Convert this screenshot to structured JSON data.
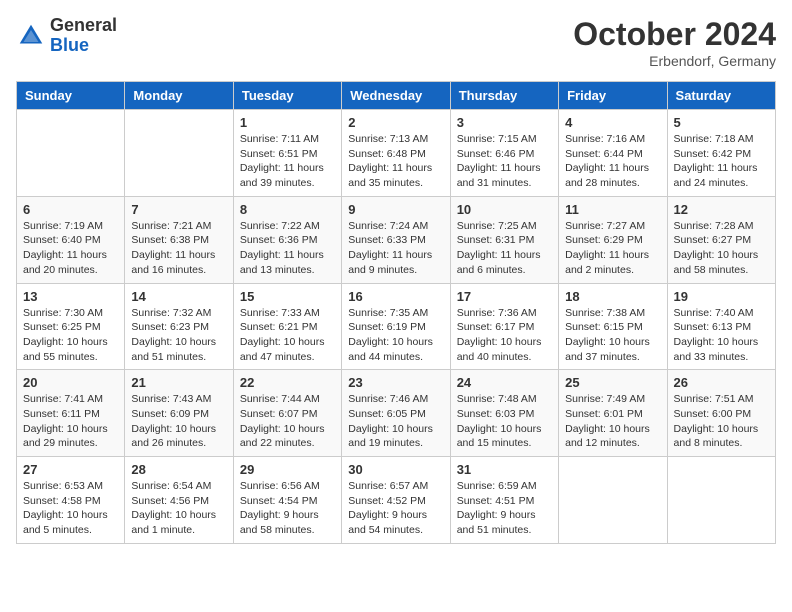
{
  "header": {
    "logo_general": "General",
    "logo_blue": "Blue",
    "month_title": "October 2024",
    "subtitle": "Erbendorf, Germany"
  },
  "days_of_week": [
    "Sunday",
    "Monday",
    "Tuesday",
    "Wednesday",
    "Thursday",
    "Friday",
    "Saturday"
  ],
  "weeks": [
    [
      {
        "day": "",
        "detail": ""
      },
      {
        "day": "",
        "detail": ""
      },
      {
        "day": "1",
        "detail": "Sunrise: 7:11 AM\nSunset: 6:51 PM\nDaylight: 11 hours and 39 minutes."
      },
      {
        "day": "2",
        "detail": "Sunrise: 7:13 AM\nSunset: 6:48 PM\nDaylight: 11 hours and 35 minutes."
      },
      {
        "day": "3",
        "detail": "Sunrise: 7:15 AM\nSunset: 6:46 PM\nDaylight: 11 hours and 31 minutes."
      },
      {
        "day": "4",
        "detail": "Sunrise: 7:16 AM\nSunset: 6:44 PM\nDaylight: 11 hours and 28 minutes."
      },
      {
        "day": "5",
        "detail": "Sunrise: 7:18 AM\nSunset: 6:42 PM\nDaylight: 11 hours and 24 minutes."
      }
    ],
    [
      {
        "day": "6",
        "detail": "Sunrise: 7:19 AM\nSunset: 6:40 PM\nDaylight: 11 hours and 20 minutes."
      },
      {
        "day": "7",
        "detail": "Sunrise: 7:21 AM\nSunset: 6:38 PM\nDaylight: 11 hours and 16 minutes."
      },
      {
        "day": "8",
        "detail": "Sunrise: 7:22 AM\nSunset: 6:36 PM\nDaylight: 11 hours and 13 minutes."
      },
      {
        "day": "9",
        "detail": "Sunrise: 7:24 AM\nSunset: 6:33 PM\nDaylight: 11 hours and 9 minutes."
      },
      {
        "day": "10",
        "detail": "Sunrise: 7:25 AM\nSunset: 6:31 PM\nDaylight: 11 hours and 6 minutes."
      },
      {
        "day": "11",
        "detail": "Sunrise: 7:27 AM\nSunset: 6:29 PM\nDaylight: 11 hours and 2 minutes."
      },
      {
        "day": "12",
        "detail": "Sunrise: 7:28 AM\nSunset: 6:27 PM\nDaylight: 10 hours and 58 minutes."
      }
    ],
    [
      {
        "day": "13",
        "detail": "Sunrise: 7:30 AM\nSunset: 6:25 PM\nDaylight: 10 hours and 55 minutes."
      },
      {
        "day": "14",
        "detail": "Sunrise: 7:32 AM\nSunset: 6:23 PM\nDaylight: 10 hours and 51 minutes."
      },
      {
        "day": "15",
        "detail": "Sunrise: 7:33 AM\nSunset: 6:21 PM\nDaylight: 10 hours and 47 minutes."
      },
      {
        "day": "16",
        "detail": "Sunrise: 7:35 AM\nSunset: 6:19 PM\nDaylight: 10 hours and 44 minutes."
      },
      {
        "day": "17",
        "detail": "Sunrise: 7:36 AM\nSunset: 6:17 PM\nDaylight: 10 hours and 40 minutes."
      },
      {
        "day": "18",
        "detail": "Sunrise: 7:38 AM\nSunset: 6:15 PM\nDaylight: 10 hours and 37 minutes."
      },
      {
        "day": "19",
        "detail": "Sunrise: 7:40 AM\nSunset: 6:13 PM\nDaylight: 10 hours and 33 minutes."
      }
    ],
    [
      {
        "day": "20",
        "detail": "Sunrise: 7:41 AM\nSunset: 6:11 PM\nDaylight: 10 hours and 29 minutes."
      },
      {
        "day": "21",
        "detail": "Sunrise: 7:43 AM\nSunset: 6:09 PM\nDaylight: 10 hours and 26 minutes."
      },
      {
        "day": "22",
        "detail": "Sunrise: 7:44 AM\nSunset: 6:07 PM\nDaylight: 10 hours and 22 minutes."
      },
      {
        "day": "23",
        "detail": "Sunrise: 7:46 AM\nSunset: 6:05 PM\nDaylight: 10 hours and 19 minutes."
      },
      {
        "day": "24",
        "detail": "Sunrise: 7:48 AM\nSunset: 6:03 PM\nDaylight: 10 hours and 15 minutes."
      },
      {
        "day": "25",
        "detail": "Sunrise: 7:49 AM\nSunset: 6:01 PM\nDaylight: 10 hours and 12 minutes."
      },
      {
        "day": "26",
        "detail": "Sunrise: 7:51 AM\nSunset: 6:00 PM\nDaylight: 10 hours and 8 minutes."
      }
    ],
    [
      {
        "day": "27",
        "detail": "Sunrise: 6:53 AM\nSunset: 4:58 PM\nDaylight: 10 hours and 5 minutes."
      },
      {
        "day": "28",
        "detail": "Sunrise: 6:54 AM\nSunset: 4:56 PM\nDaylight: 10 hours and 1 minute."
      },
      {
        "day": "29",
        "detail": "Sunrise: 6:56 AM\nSunset: 4:54 PM\nDaylight: 9 hours and 58 minutes."
      },
      {
        "day": "30",
        "detail": "Sunrise: 6:57 AM\nSunset: 4:52 PM\nDaylight: 9 hours and 54 minutes."
      },
      {
        "day": "31",
        "detail": "Sunrise: 6:59 AM\nSunset: 4:51 PM\nDaylight: 9 hours and 51 minutes."
      },
      {
        "day": "",
        "detail": ""
      },
      {
        "day": "",
        "detail": ""
      }
    ]
  ]
}
